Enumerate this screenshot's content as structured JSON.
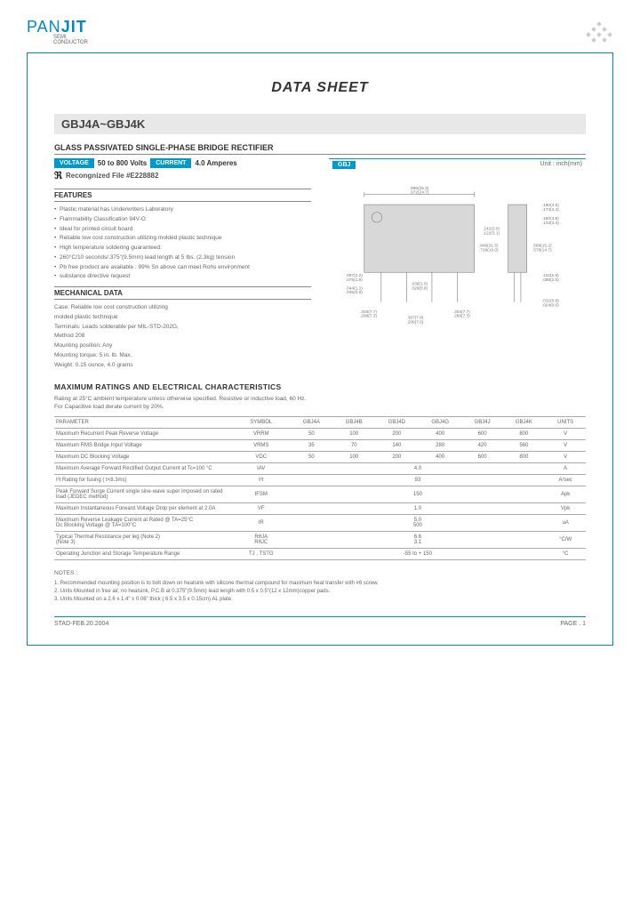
{
  "logo": {
    "pan": "PAN",
    "jit": "JIT",
    "sub1": "SEMI",
    "sub2": "CONDUCTOR"
  },
  "title": "DATA  SHEET",
  "part_no": "GBJ4A~GBJ4K",
  "desc_title": "GLASS PASSIVATED SINGLE-PHASE BRIDGE RECTIFIER",
  "badges": {
    "voltage_label": "VOLTAGE",
    "voltage_val": "50 to 800 Volts",
    "current_label": "CURRENT",
    "current_val": "4.0 Amperes"
  },
  "ul": {
    "mark": "ℜ",
    "text": "Recongnized File #E228882"
  },
  "features_header": "FEATURES",
  "features": [
    "Plastic material has Underwriters Laboratory",
    "Flammability Classification 94V-O",
    "Ideal for printed circuit board",
    "Reliable low cost construction utilizing molded plastic technique",
    "High temperature soldering guaranteed:",
    "260°C/10 seconds/.375\"(9.5mm) lead length at 5 lbs. (2.3kg) tension",
    "Pb free product are available : 99% Sn above can meet Rohs environment",
    "substance directive request"
  ],
  "mech_header": "MECHANICAL DATA",
  "mech": [
    "Case: Reliable low cost construction utilizing",
    "molded plastic technique",
    "Terminals: Leads solderable per MIL-STD-202G,",
    "Method 208",
    "Mounting position: Any",
    "Mounting torque: 5 in. lb. Max.",
    "Weight: 0.15 ounce, 4.0 grams"
  ],
  "diagram": {
    "gbj": "GBJ",
    "unit": "Unit : inch(mm)",
    "dims": {
      "d1": ".996(25.3)",
      "d2": ".972(24.7)",
      "d3": ".180(4.6)",
      "d4": ".173(4.4)",
      "d5": ".150(3.8)",
      "d6": ".133(3.4)",
      "d7": ".142(3.6)",
      "d8": ".122(3.1)",
      "d9": ".846(21.5)",
      "d10": ".728(19.0)",
      "d11": ".598(15.2)",
      "d12": ".578(14.7)",
      "d13": ".087(2.2)",
      "d14": ".075(1.9)",
      "d15": ".044(1.1)",
      "d16": ".035(0.9)",
      "d17": ".039(1.0)",
      "d18": ".029(0.8)",
      "d19": ".304(7.7)",
      "d20": ".288(7.3)",
      "d21": ".304(7.7)",
      "d22": ".288(7.3)",
      "d23": ".307(7.8)",
      "d24": ".299(7.6)",
      "d25": ".115(2.9)",
      "d26": ".098(2.5)",
      "d27": ".032(0.8)",
      "d28": ".024(0.6)"
    }
  },
  "ratings_title": "MAXIMUM RATINGS AND ELECTRICAL CHARACTERISTICS",
  "ratings_sub1": "Rating at 25°C ambient temperature unless otherwise specified. Resistive or inductive load, 60 Hz.",
  "ratings_sub2": "For Capacitive load derate current by 20%.",
  "table": {
    "headers": [
      "PARAMETER",
      "SYMBOL",
      "GBJ4A",
      "GBJ4B",
      "GBJ4D",
      "GBJ4G",
      "GBJ4J",
      "GBJ4K",
      "UNITS"
    ],
    "rows": [
      {
        "param": "Maximum Recurrent Peak Reverse Voltage",
        "sym": "VRRM",
        "v": [
          "50",
          "100",
          "200",
          "400",
          "600",
          "800"
        ],
        "u": "V"
      },
      {
        "param": "Maximum RMS Bridge Input Voltage",
        "sym": "VRMS",
        "v": [
          "35",
          "70",
          "140",
          "280",
          "420",
          "560"
        ],
        "u": "V"
      },
      {
        "param": "Maximum DC Blocking Voltage",
        "sym": "VDC",
        "v": [
          "50",
          "100",
          "200",
          "400",
          "600",
          "800"
        ],
        "u": "V"
      },
      {
        "param": "Maximum Average Forward Rectified Output Current at Tc=100 °C",
        "sym": "IAV",
        "span": "4.0",
        "u": "A"
      },
      {
        "param": "I²t Rating for fusing ( t<8.3ms)",
        "sym": "I²t",
        "span": "93",
        "u": "A²sec"
      },
      {
        "param": "Peak Forward Surge Current single sine-wave super imposed on rated load (JEDEC method)",
        "sym": "IFSM",
        "span": "150",
        "u": "Apk"
      },
      {
        "param": "Maximum Instantaneous Forward Voltage Drop per element at 2.0A",
        "sym": "VF",
        "span": "1.0",
        "u": "Vpk"
      },
      {
        "param": "Maximum Reverse Leakage Current at Rated @ TA=25°C\nDc Blocking Voltage @ TA=100°C",
        "sym": "IR",
        "span": "5.0\n500",
        "u": "uA"
      },
      {
        "param": "Typical Thermal Resistance per leg (Note 2)\n                                                   (Note 3)",
        "sym": "RθJA\nRθJC",
        "span": "6.6\n3.1",
        "u": "°C/W"
      },
      {
        "param": "Operating Junction and Storage Temperature Range",
        "sym": "TJ , TSTG",
        "span": "-55 to + 150",
        "u": "°C"
      }
    ]
  },
  "notes_title": "NOTES :",
  "notes": [
    "1. Recommended mounting position is to bolt down on heatsink with silicone thermal compound for maximum heat transfer with #6 screw.",
    "2. Units Mounted in free air, no heatsink, P.C.B at 0.375\"(9.5mm) lead length with 0.5 x 0.5\"(12 x 12mm)copper pads.",
    "3. Units Mounted on a 2.6 x 1.4\" x 0.06\" thick ( 6.5 x 3.5 x 0.15cm) AL plate."
  ],
  "footer": {
    "left": "STAD-FEB.20.2004",
    "right": "PAGE  . 1"
  }
}
